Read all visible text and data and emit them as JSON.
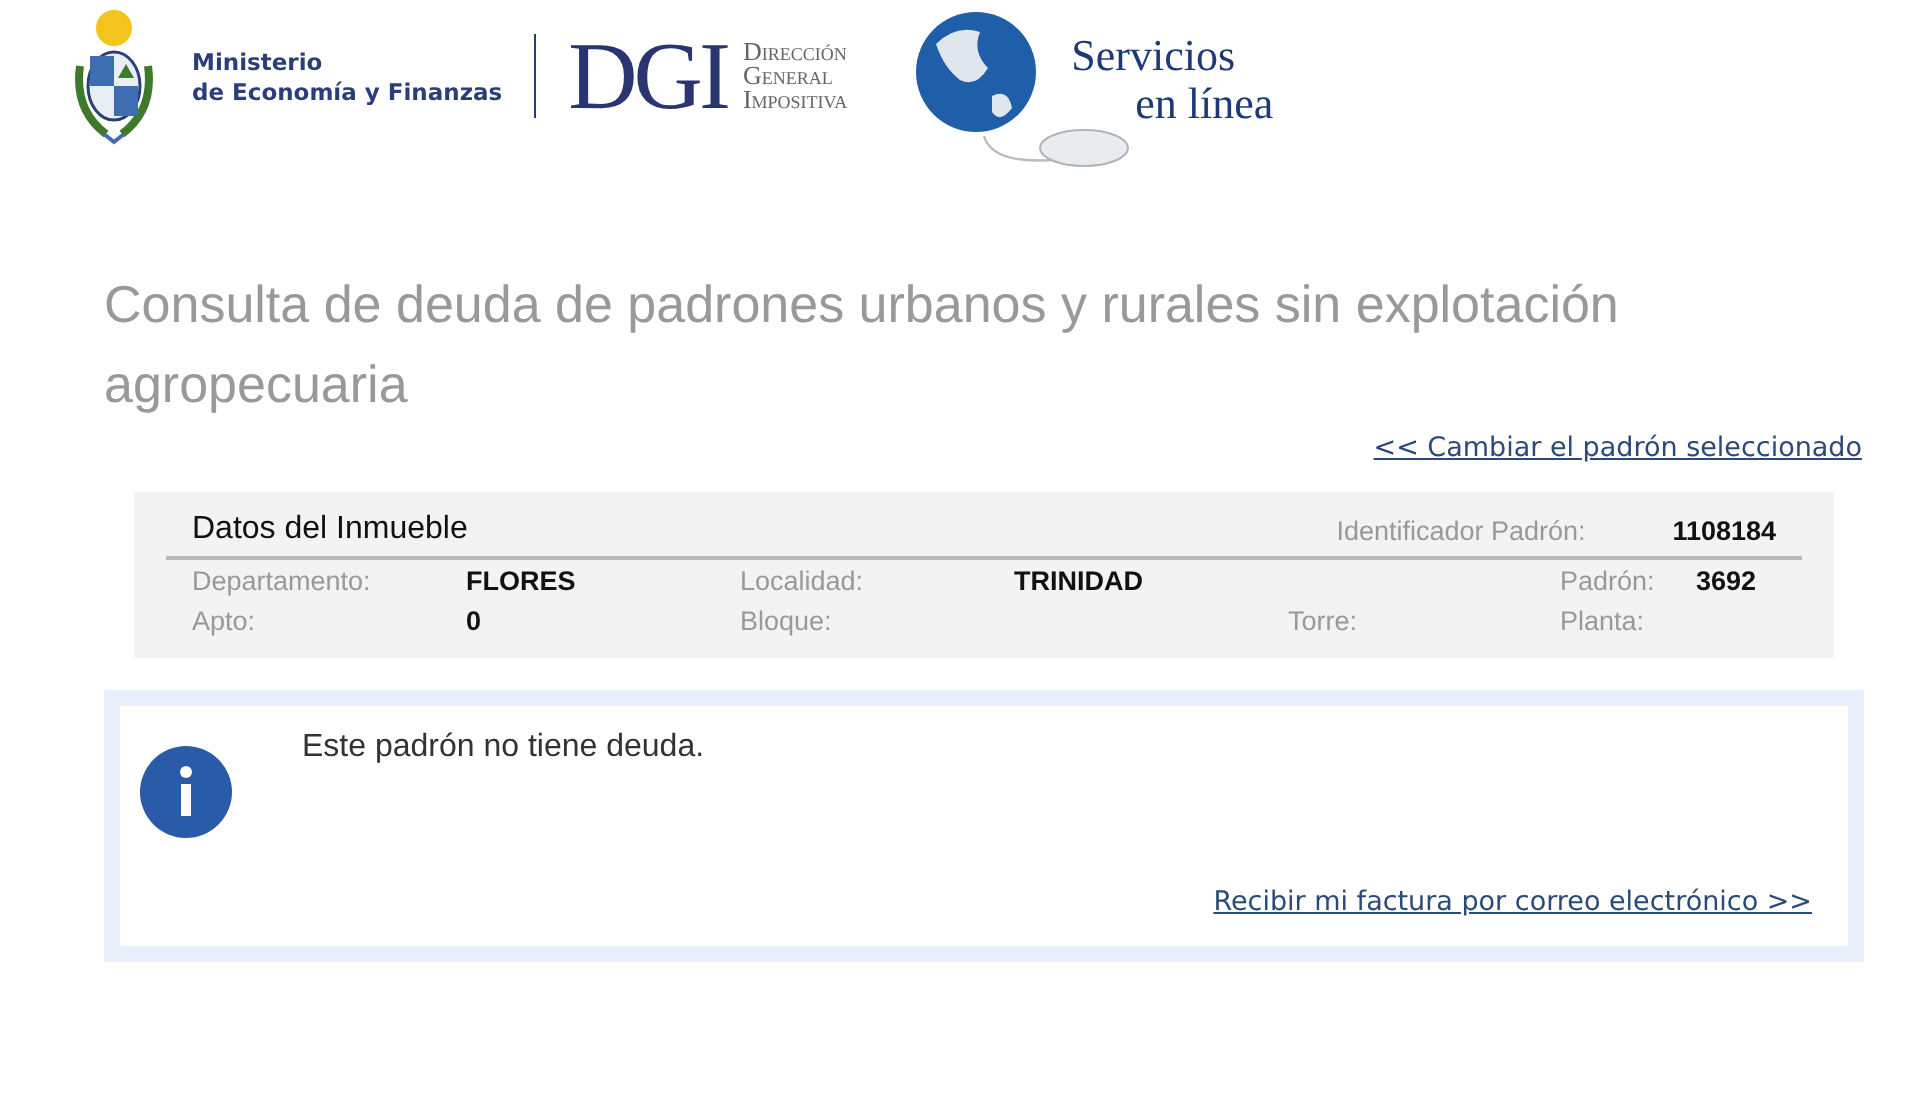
{
  "header": {
    "ministry": [
      "Ministerio",
      "de Economía y Finanzas"
    ],
    "dgi": "DGI",
    "dgi_name": [
      "Dirección",
      "General",
      "Impositiva"
    ],
    "services": [
      "Servicios",
      "en línea"
    ]
  },
  "title": "Consulta de deuda de padrones urbanos y rurales sin explotación agropecuaria",
  "change_link": "<< Cambiar el padrón seleccionado",
  "property": {
    "heading": "Datos del Inmueble",
    "id_label": "Identificador Padrón:",
    "id_value": "1108184",
    "rows": [
      [
        {
          "kind": "label",
          "text": "Departamento:"
        },
        {
          "kind": "value",
          "text": "FLORES"
        },
        {
          "kind": "label",
          "text": "Localidad:"
        },
        {
          "kind": "value",
          "text": "TRINIDAD"
        },
        {
          "kind": "blank"
        },
        {
          "kind": "label",
          "text": "Padrón:"
        },
        {
          "kind": "value",
          "text": "3692"
        }
      ],
      [
        {
          "kind": "label",
          "text": "Apto:"
        },
        {
          "kind": "value",
          "text": "0"
        },
        {
          "kind": "label",
          "text": "Bloque:"
        },
        {
          "kind": "blank"
        },
        {
          "kind": "label",
          "text": "Torre:"
        },
        {
          "kind": "label",
          "text": "Planta:"
        },
        {
          "kind": "blank"
        }
      ]
    ]
  },
  "notice": {
    "message": "Este padrón no tiene deuda.",
    "link": "Recibir mi factura por correo electrónico >>"
  }
}
